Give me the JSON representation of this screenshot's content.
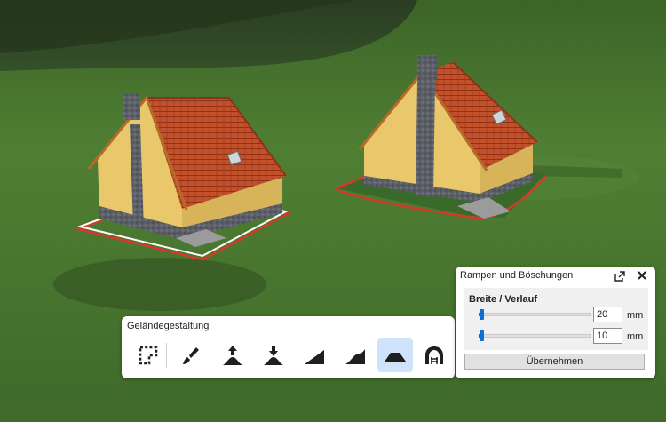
{
  "toolbar": {
    "title": "Geländegestaltung",
    "tools": [
      {
        "icon": "terrain-outline-icon",
        "active": false
      },
      {
        "icon": "paint-brush-icon",
        "active": false
      },
      {
        "icon": "raise-terrain-icon",
        "active": false
      },
      {
        "icon": "lower-terrain-icon",
        "active": false
      },
      {
        "icon": "slope-icon",
        "active": false
      },
      {
        "icon": "curved-slope-icon",
        "active": false
      },
      {
        "icon": "ramp-embankment-icon",
        "active": true
      },
      {
        "icon": "tunnel-icon",
        "active": false
      }
    ]
  },
  "panel": {
    "title": "Rampen und Böschungen",
    "section_label": "Breite / Verlauf",
    "width_value": "20",
    "width_unit": "mm",
    "width_level": 0.02,
    "gradient_value": "10",
    "gradient_unit": "mm",
    "gradient_level": 0.02,
    "apply_label": "Übernehmen"
  },
  "colors": {
    "accent": "#0d6fd6",
    "active_tool_bg": "#cfe3fb",
    "grass": "#4c7a33",
    "wall": "#e8c86a",
    "roof": "#c4502a",
    "selection_red": "#d23a2a"
  }
}
